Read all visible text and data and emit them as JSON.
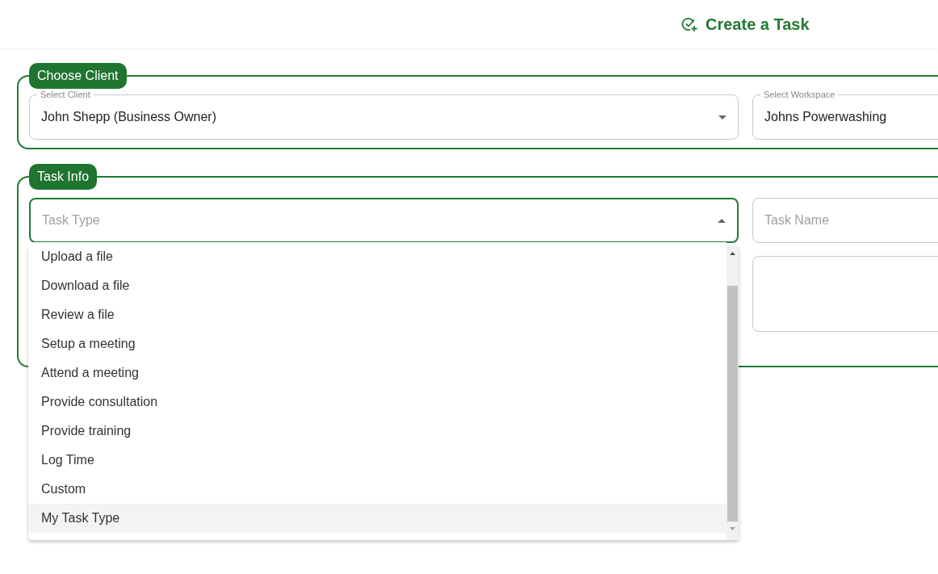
{
  "header": {
    "title": "Create a Task"
  },
  "client_section": {
    "legend": "Choose Client",
    "client": {
      "label": "Select Client",
      "value": "John Shepp (Business Owner)"
    },
    "workspace": {
      "label": "Select Workspace",
      "value": "Johns Powerwashing"
    }
  },
  "task_section": {
    "legend": "Task Info",
    "task_type": {
      "placeholder": "Task Type",
      "expanded": true
    },
    "task_name": {
      "placeholder": "Task Name"
    }
  },
  "task_type_options": [
    {
      "label": "Upload a file",
      "highlighted": false
    },
    {
      "label": "Download a file",
      "highlighted": false
    },
    {
      "label": "Review a file",
      "highlighted": false
    },
    {
      "label": "Setup a meeting",
      "highlighted": false
    },
    {
      "label": "Attend a meeting",
      "highlighted": false
    },
    {
      "label": "Provide consultation",
      "highlighted": false
    },
    {
      "label": "Provide training",
      "highlighted": false
    },
    {
      "label": "Log Time",
      "highlighted": false
    },
    {
      "label": "Custom",
      "highlighted": false
    },
    {
      "label": "My Task Type",
      "highlighted": true
    }
  ]
}
